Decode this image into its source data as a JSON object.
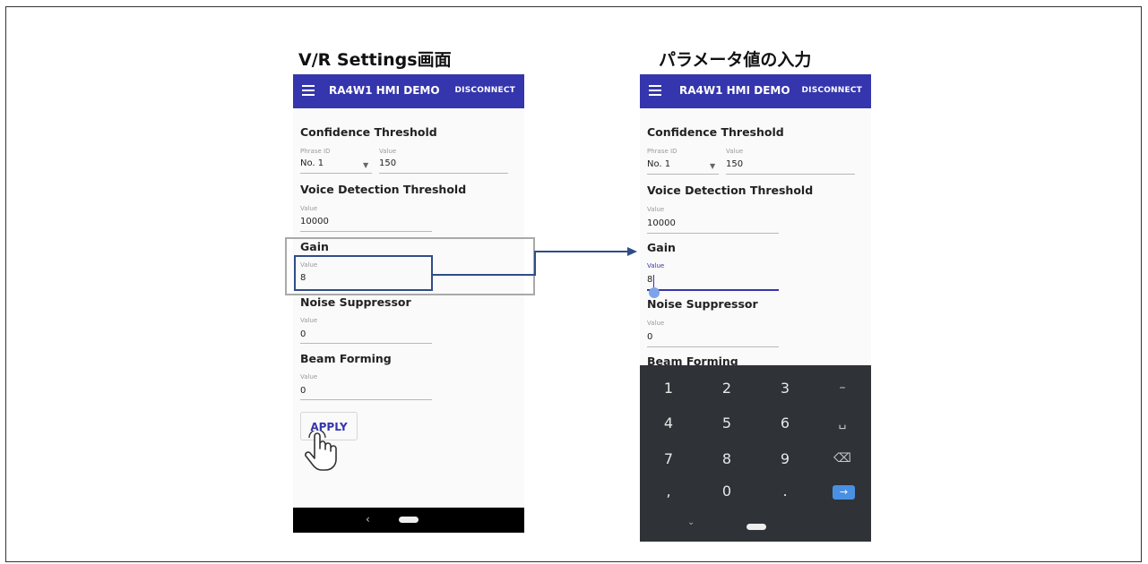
{
  "captions": {
    "left": "V/R Settings画面",
    "right": "パラメータ値の入力"
  },
  "app": {
    "title": "RA4W1 HMI DEMO",
    "disconnect_label": "DISCONNECT"
  },
  "confidence": {
    "title": "Confidence Threshold",
    "phrase_label": "Phrase ID",
    "phrase_value": "No. 1",
    "value_label": "Value",
    "value": "150"
  },
  "voice_detection": {
    "title": "Voice Detection Threshold",
    "value_label": "Value",
    "value": "10000"
  },
  "gain": {
    "title": "Gain",
    "value_label": "Value",
    "value": "8"
  },
  "noise_suppressor": {
    "title": "Noise Suppressor",
    "value_label": "Value",
    "value": "0"
  },
  "beam_forming": {
    "title": "Beam Forming",
    "value_label": "Value",
    "value": "0"
  },
  "apply_label": "APPLY",
  "navbar": {
    "back_glyph": "‹"
  },
  "keyboard": {
    "keys": [
      "1",
      "2",
      "3",
      "–",
      "4",
      "5",
      "6",
      "␣",
      "7",
      "8",
      "9",
      "⌫",
      ",",
      "0",
      ".",
      "→"
    ],
    "hide_glyph": "⌄"
  },
  "colors": {
    "app_bar": "#3535ad",
    "accent": "#3535ad",
    "keyboard_bg": "#2f3237",
    "go_key": "#4a90e2",
    "highlight_outer": "#a9a9a9",
    "highlight_inner": "#2f4d88"
  },
  "icons": {
    "menu": "hamburger-menu-icon",
    "pointer": "hand-pointer-icon",
    "dropdown": "dropdown-caret-icon",
    "backspace": "backspace-icon",
    "go": "go-arrow-icon"
  }
}
